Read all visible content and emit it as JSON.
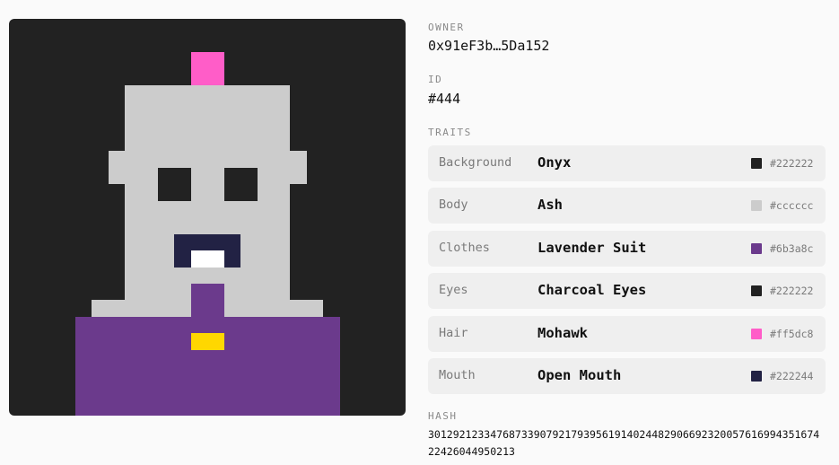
{
  "owner": {
    "label": "OWNER",
    "value": "0x91eF3b…5Da152"
  },
  "id": {
    "label": "ID",
    "value": "#444"
  },
  "traits": {
    "label": "TRAITS",
    "items": [
      {
        "name": "Background",
        "value": "Onyx",
        "hex": "#222222",
        "color": "#222222"
      },
      {
        "name": "Body",
        "value": "Ash",
        "hex": "#cccccc",
        "color": "#cccccc"
      },
      {
        "name": "Clothes",
        "value": "Lavender Suit",
        "hex": "#6b3a8c",
        "color": "#6b3a8c"
      },
      {
        "name": "Eyes",
        "value": "Charcoal Eyes",
        "hex": "#222222",
        "color": "#222222"
      },
      {
        "name": "Hair",
        "value": "Mohawk",
        "hex": "#ff5dc8",
        "color": "#ff5dc8"
      },
      {
        "name": "Mouth",
        "value": "Open Mouth",
        "hex": "#222244",
        "color": "#222244"
      }
    ]
  },
  "hash": {
    "label": "HASH",
    "value": "30129212334768733907921793956191402448290669232005761699435167422426044950213"
  },
  "colors": {
    "background": "#222222",
    "body": "#cccccc",
    "clothes": "#6b3a8c",
    "eyes": "#222222",
    "hair": "#ff5dc8",
    "mouth": "#222244",
    "teeth": "#ffffff",
    "pendant": "#ffd700"
  }
}
